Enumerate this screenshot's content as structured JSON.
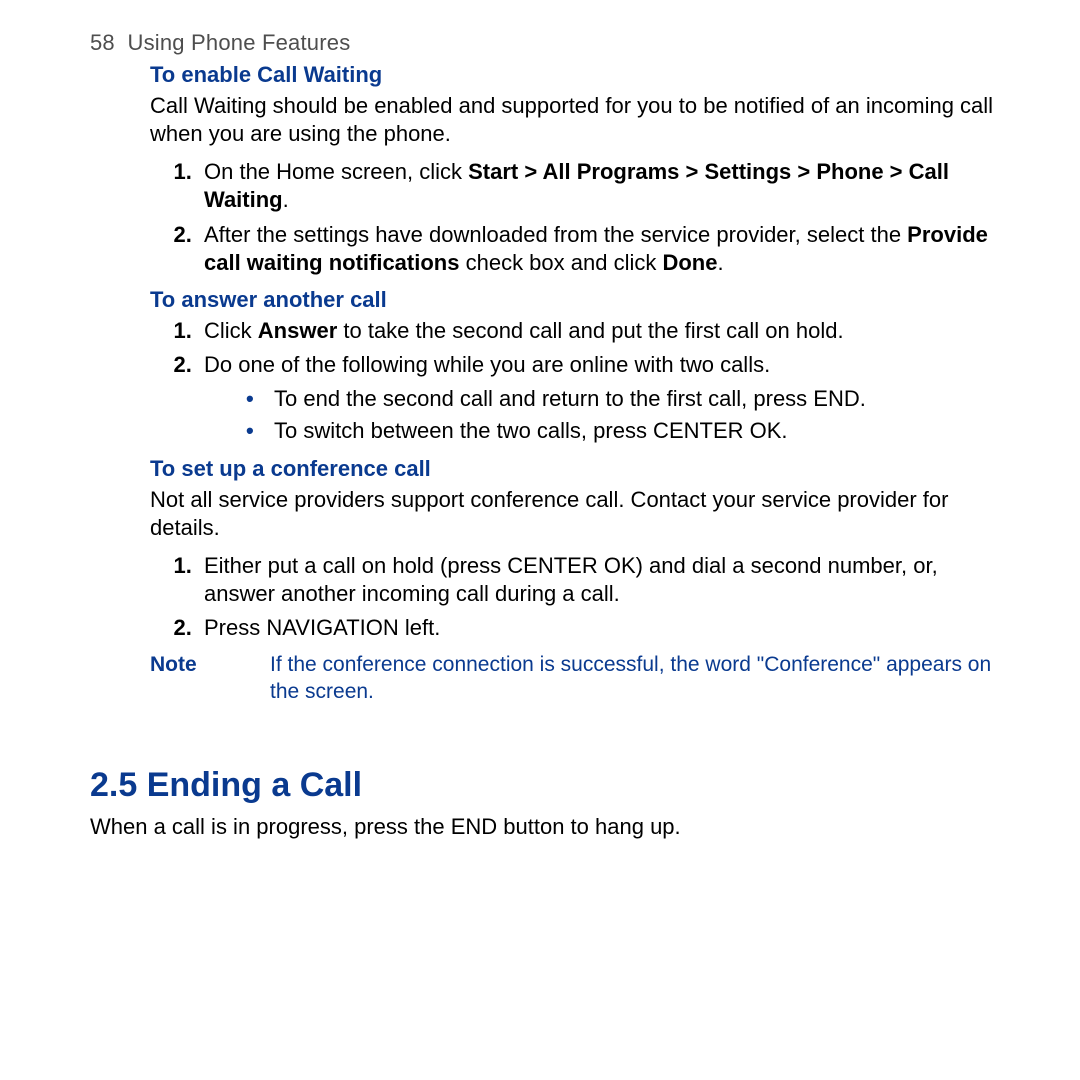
{
  "header": {
    "page_number": "58",
    "chapter_title": "Using Phone Features"
  },
  "sections": {
    "enable_call_waiting": {
      "title": "To enable Call Waiting",
      "intro": "Call Waiting should be enabled and supported for you to be notified of an incoming call when you are using the phone.",
      "step1_pre": "On the Home screen, click ",
      "step1_bold1": "Start > All Programs > Settings > Phone > Call Waiting",
      "step1_post": ".",
      "step2_pre": "After the settings have downloaded from the service provider, select the ",
      "step2_bold1": "Provide call waiting notifications",
      "step2_mid": " check box and click ",
      "step2_bold2": "Done",
      "step2_post": "."
    },
    "answer_another": {
      "title": "To answer another call",
      "step1_pre": "Click ",
      "step1_bold": "Answer",
      "step1_post": " to take the second call and put the first call on hold.",
      "step2": "Do one of the following while you are online with two calls.",
      "bullet1": "To end the second call and return to the first call, press END.",
      "bullet2": "To switch between the two calls, press CENTER OK."
    },
    "conference": {
      "title": "To set up a conference call",
      "intro": "Not all service providers support conference call. Contact your service provider for details.",
      "step1": "Either put a call on hold (press CENTER OK) and dial a second number, or, answer another incoming call during a call.",
      "step2": "Press NAVIGATION left.",
      "note_label": "Note",
      "note_text": "If the conference connection is successful, the word \"Conference\" appears on the screen."
    },
    "ending": {
      "heading": "2.5  Ending a Call",
      "body": "When a call is in progress, press the END button to hang up."
    }
  }
}
